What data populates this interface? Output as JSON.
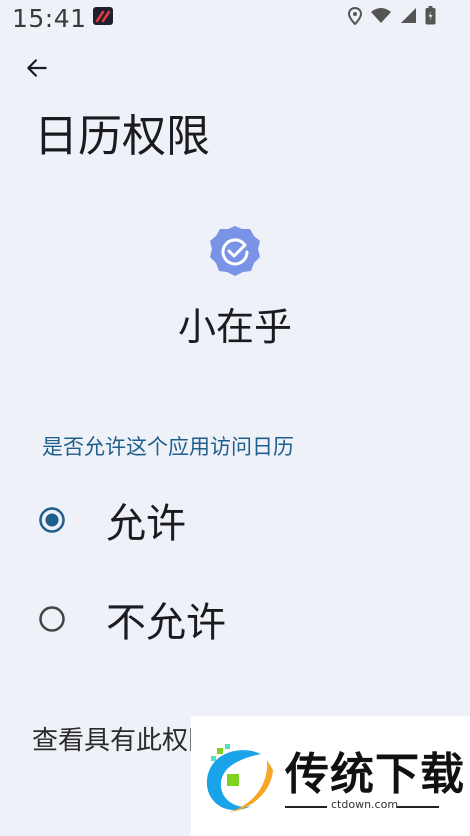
{
  "status_bar": {
    "time": "15:41",
    "icons": [
      "location-icon",
      "wifi-icon",
      "signal-icon",
      "battery-icon"
    ]
  },
  "header": {
    "back_icon": "arrow-left-icon",
    "title": "日历权限"
  },
  "app": {
    "name": "小在乎",
    "icon": "check-badge-icon",
    "icon_color": "#7b93e6"
  },
  "section": {
    "header": "是否允许这个应用访问日历",
    "header_color": "#1f5f8b"
  },
  "options": [
    {
      "label": "允许",
      "selected": true
    },
    {
      "label": "不允许",
      "selected": false
    }
  ],
  "footer": {
    "text": "查看具有此权限的所有应用"
  },
  "watermark": {
    "brand": "传统下载",
    "url": "ctdown.com"
  },
  "colors": {
    "background": "#eef1f8",
    "radio_selected": "#1f5f8b",
    "radio_unselected": "#444444"
  }
}
